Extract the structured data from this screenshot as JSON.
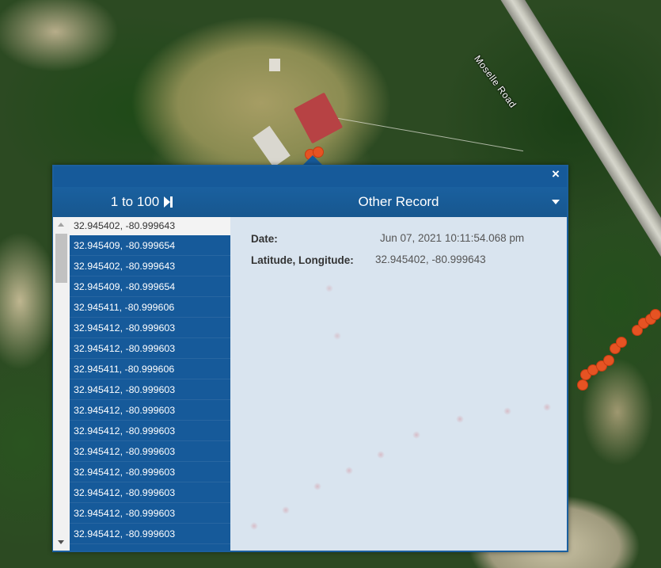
{
  "map": {
    "road_label": "Moselle Road",
    "marker_color": "#e65323"
  },
  "popup": {
    "close_label": "×",
    "list_header": {
      "range_label": "1 to 100",
      "next_icon": "skip-next-icon"
    },
    "record_header": {
      "title": "Other Record",
      "dropdown_icon": "caret-down-icon"
    },
    "records": [
      "32.945402, -80.999643",
      "32.945409, -80.999654",
      "32.945402, -80.999643",
      "32.945409, -80.999654",
      "32.945411, -80.999606",
      "32.945412, -80.999603",
      "32.945412, -80.999603",
      "32.945411, -80.999606",
      "32.945412, -80.999603",
      "32.945412, -80.999603",
      "32.945412, -80.999603",
      "32.945412, -80.999603",
      "32.945412, -80.999603",
      "32.945412, -80.999603",
      "32.945412, -80.999603",
      "32.945412, -80.999603"
    ],
    "selected_index": 0,
    "detail": {
      "date_label": "Date:",
      "date_value": "Jun 07, 2021 10:11:54.068 pm",
      "latlng_label": "Latitude, Longitude:",
      "latlng_value": "32.945402, -80.999643"
    },
    "colors": {
      "header_bg": "#165a9a",
      "selected_bg": "#f3f3f3"
    }
  }
}
